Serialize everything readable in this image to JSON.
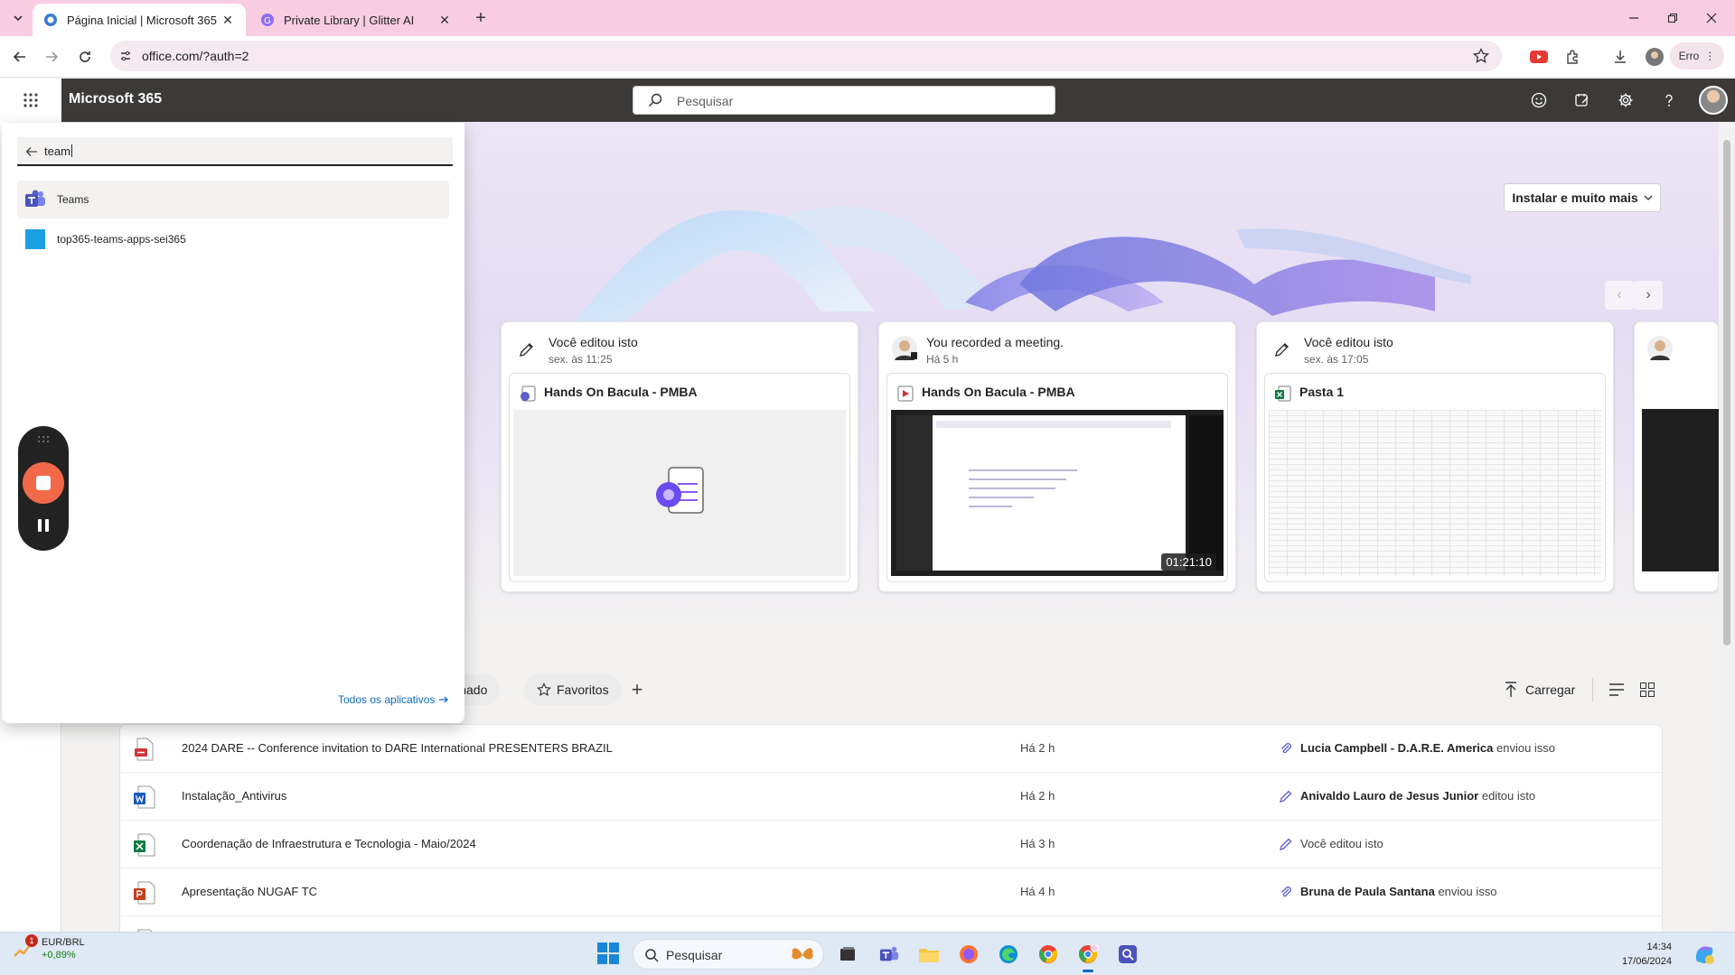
{
  "browser": {
    "tabs": [
      {
        "title": "Página Inicial | Microsoft 365",
        "active": true,
        "favicon": "microsoft-365-logo"
      },
      {
        "title": "Private Library | Glitter AI",
        "active": false,
        "favicon": "glitter-ai-logo"
      }
    ],
    "url": "office.com/?auth=2",
    "profile_status": "Erro"
  },
  "m365": {
    "brand": "Microsoft 365",
    "search_placeholder": "Pesquisar"
  },
  "hero": {
    "install_button": "Instalar e muito mais"
  },
  "recommended": [
    {
      "activity": "Você editou isto",
      "when": "sex. às 11:25",
      "file": "Hands On Bacula - PMBA",
      "type": "loop",
      "thumbnail": "loop-document-icon"
    },
    {
      "activity": "You recorded a meeting.",
      "when": "Há 5 h",
      "file": "Hands On Bacula - PMBA",
      "type": "video",
      "duration": "01:21:10"
    },
    {
      "activity": "Você editou isto",
      "when": "sex. às 17:05",
      "file": "Pasta 1",
      "type": "excel"
    }
  ],
  "filters": {
    "partial_chip": "ilhado",
    "favorites": "Favoritos",
    "upload": "Carregar"
  },
  "files": [
    {
      "name": "2024 DARE -- Conference invitation to DARE International PRESENTERS BRAZIL",
      "time": "Há 2 h",
      "actor": "Lucia Campbell - D.A.R.E. America",
      "action": "enviou isso",
      "type": "pdf"
    },
    {
      "name": "Instalação_Antivirus",
      "time": "Há 2 h",
      "actor": "Anivaldo Lauro de Jesus Junior",
      "action": "editou isto",
      "type": "word"
    },
    {
      "name": "Coordenação de Infraestrutura e Tecnologia - Maio/2024",
      "time": "Há 3 h",
      "actor": "",
      "action": "Você editou isto",
      "type": "excel"
    },
    {
      "name": "Apresentação NUGAF TC",
      "time": "Há 4 h",
      "actor": "Bruna de Paula Santana",
      "action": "enviou isso",
      "type": "powerpoint"
    }
  ],
  "flyout": {
    "search_value": "team",
    "results": [
      {
        "label": "Teams",
        "icon": "teams-icon"
      },
      {
        "label": "top365-teams-apps-sei365",
        "icon": "custom-app-tile"
      }
    ],
    "all_apps": "Todos os aplicativos"
  },
  "taskbar": {
    "widget_title": "EUR/BRL",
    "widget_value": "+0,89%",
    "widget_badge": "1",
    "search_placeholder": "Pesquisar",
    "time": "14:34",
    "date": "17/06/2024"
  },
  "colors": {
    "tab_strip": "#f8cde1",
    "m365_header": "#3b3a39",
    "teams_purple": "#5b5fc7",
    "excel_green": "#107c41",
    "word_blue": "#185abd",
    "ppt_orange": "#c43e1c",
    "pdf_red": "#d13438",
    "record_orange": "#f2694a",
    "link_blue": "#0f6cbd"
  }
}
